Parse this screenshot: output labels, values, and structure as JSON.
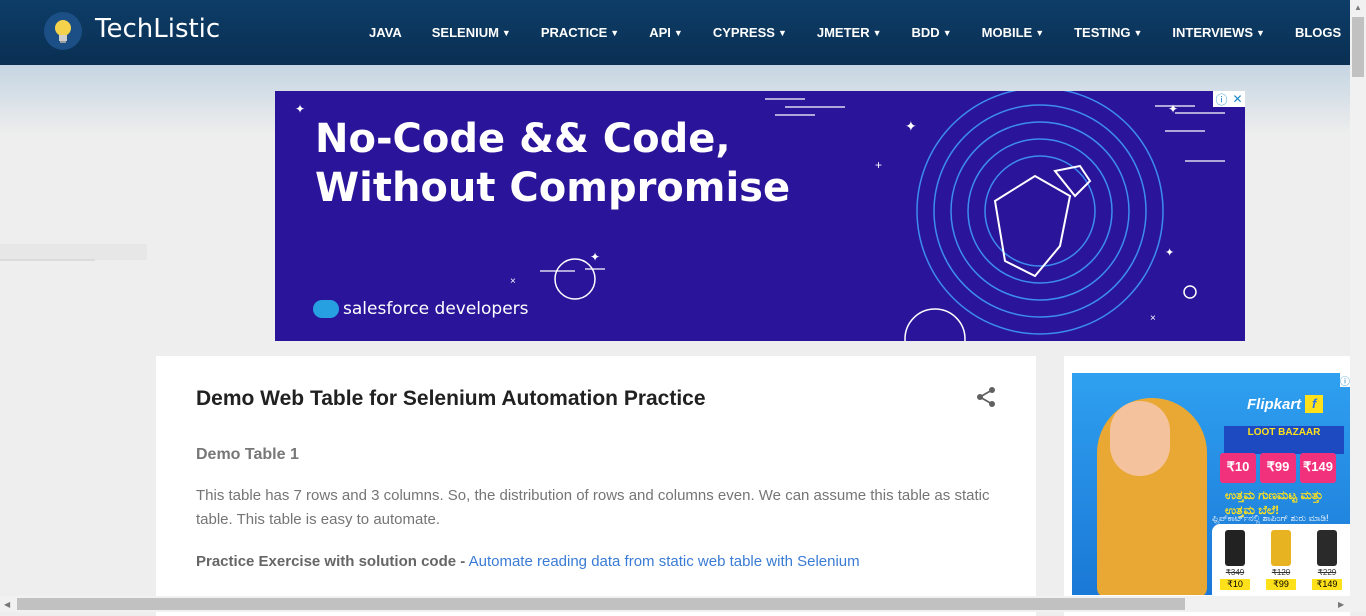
{
  "header": {
    "logo_text": "TechListic",
    "nav": [
      {
        "label": "JAVA",
        "dropdown": false
      },
      {
        "label": "SELENIUM",
        "dropdown": true
      },
      {
        "label": "PRACTICE",
        "dropdown": true
      },
      {
        "label": "API",
        "dropdown": true
      },
      {
        "label": "CYPRESS",
        "dropdown": true
      },
      {
        "label": "JMETER",
        "dropdown": true
      },
      {
        "label": "BDD",
        "dropdown": true
      },
      {
        "label": "MOBILE",
        "dropdown": true
      },
      {
        "label": "TESTING",
        "dropdown": true
      },
      {
        "label": "INTERVIEWS",
        "dropdown": true
      },
      {
        "label": "BLOGS",
        "dropdown": false
      }
    ]
  },
  "ad": {
    "headline_line1": "No-Code && Code,",
    "headline_line2": "Without Compromise",
    "brand": "salesforce developers"
  },
  "post": {
    "title": "Demo Web Table for Selenium Automation Practice",
    "subtitle": "Demo Table 1",
    "paragraph": "This table has 7 rows and 3 columns. So, the distribution of rows and columns even. We can assume this table as static table. This table is easy to automate.",
    "exercise_label": "Practice Exercise with solution code -",
    "exercise_link": "Automate reading data from static web table with Selenium"
  },
  "side_ad": {
    "brand": "Flipkart",
    "loot_title": "LOOT BAZAAR",
    "prices": [
      "₹10",
      "₹99",
      "₹149"
    ],
    "kannada_line": "ಉತ್ತಮ ಗುಣಮಟ್ಟ ಮತ್ತು ಉತ್ತಮ ಬೆಲೆ!",
    "kannada_sub": "ಫ್ಲಿಪ್‌ಕಾರ್ಟ್‌ನಲ್ಲಿ ಶಾಪಿಂಗ್ ಶುರು ಮಾಡಿ!",
    "products": [
      {
        "old": "₹349",
        "price": "₹10"
      },
      {
        "old": "₹120",
        "price": "₹99"
      },
      {
        "old": "₹229",
        "price": "₹149"
      }
    ]
  },
  "colors": {
    "header_bg": "#0a2f52",
    "ad_bg": "#2a159a",
    "link": "#3a7bd5"
  }
}
